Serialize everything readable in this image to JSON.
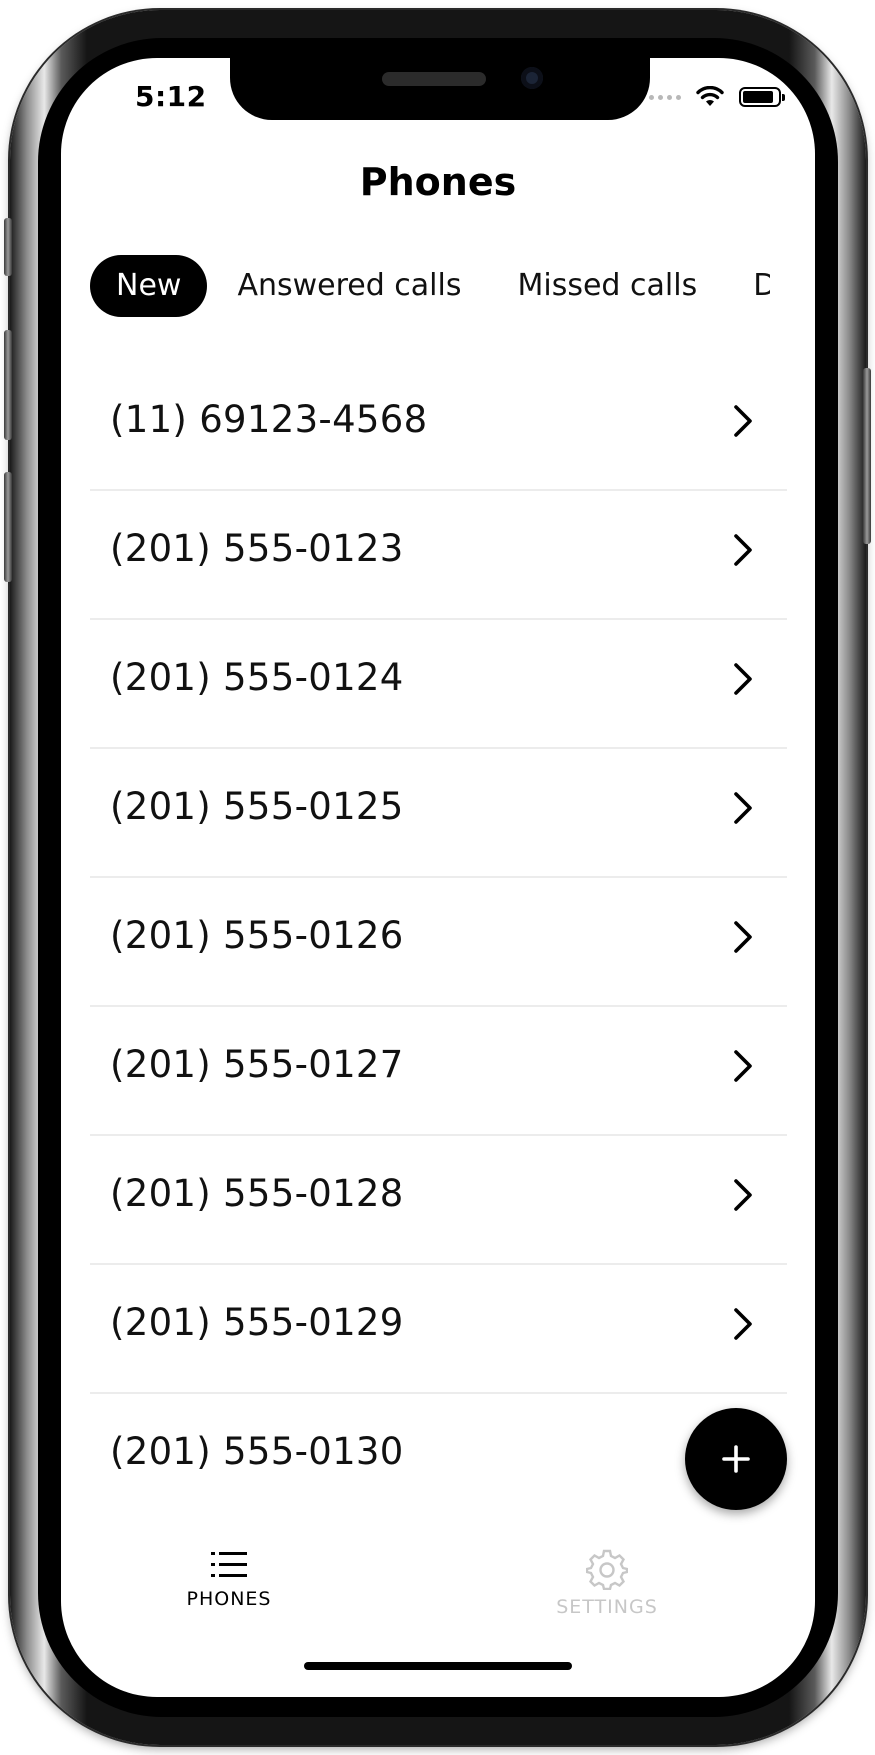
{
  "status_bar": {
    "time": "5:12"
  },
  "header": {
    "title": "Phones"
  },
  "tabs": [
    {
      "label": "New",
      "active": true
    },
    {
      "label": "Answered calls",
      "active": false
    },
    {
      "label": "Missed calls",
      "active": false
    },
    {
      "label": "Do",
      "active": false
    }
  ],
  "phones": [
    {
      "number": "(11) 69123-4568",
      "icon": "chevron-right-icon"
    },
    {
      "number": "(201) 555-0123",
      "icon": "chevron-right-icon"
    },
    {
      "number": "(201) 555-0124",
      "icon": "chevron-right-icon"
    },
    {
      "number": "(201) 555-0125",
      "icon": "chevron-right-icon"
    },
    {
      "number": "(201) 555-0126",
      "icon": "chevron-right-icon"
    },
    {
      "number": "(201) 555-0127",
      "icon": "chevron-right-icon"
    },
    {
      "number": "(201) 555-0128",
      "icon": "chevron-right-icon"
    },
    {
      "number": "(201) 555-0129",
      "icon": "chevron-right-icon"
    },
    {
      "number": "(201) 555-0130",
      "icon": ""
    }
  ],
  "fab": {
    "icon": "plus-icon"
  },
  "tab_bar": {
    "phones": {
      "label": "PHONES",
      "icon": "list-icon",
      "color": "#000000"
    },
    "settings": {
      "label": "SETTINGS",
      "icon": "gear-icon",
      "color": "#c7c7c7"
    }
  },
  "colors": {
    "accent": "#000000",
    "inactive": "#c7c7c7",
    "divider": "#ececec"
  }
}
